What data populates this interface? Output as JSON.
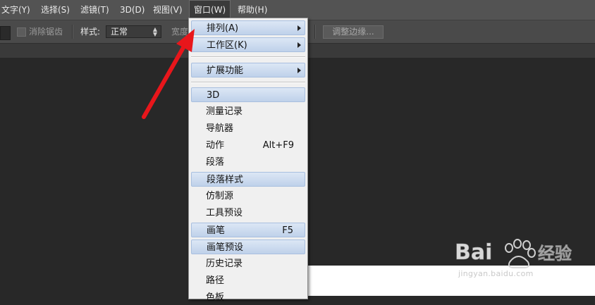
{
  "menubar": {
    "items": [
      "文字(Y)",
      "选择(S)",
      "滤镜(T)",
      "3D(D)",
      "视图(V)",
      "窗口(W)",
      "帮助(H)"
    ]
  },
  "options": {
    "antialias_label": "消除锯齿",
    "style_label": "样式:",
    "style_value": "正常",
    "width_label": "宽度",
    "refine_edge_label": "调整边缘..."
  },
  "window_menu": {
    "items": [
      {
        "label": "排列(A)",
        "shortcut": "",
        "submenu": true,
        "highlighted": true
      },
      {
        "label": "工作区(K)",
        "shortcut": "",
        "submenu": true,
        "highlighted": true
      },
      {
        "label": "扩展功能",
        "shortcut": "",
        "submenu": true,
        "highlighted": true
      },
      {
        "label": "3D",
        "shortcut": "",
        "submenu": false,
        "highlighted": true
      },
      {
        "label": "测量记录",
        "shortcut": "",
        "submenu": false,
        "highlighted": false
      },
      {
        "label": "导航器",
        "shortcut": "",
        "submenu": false,
        "highlighted": false
      },
      {
        "label": "动作",
        "shortcut": "Alt+F9",
        "submenu": false,
        "highlighted": false
      },
      {
        "label": "段落",
        "shortcut": "",
        "submenu": false,
        "highlighted": false
      },
      {
        "label": "段落样式",
        "shortcut": "",
        "submenu": false,
        "highlighted": true
      },
      {
        "label": "仿制源",
        "shortcut": "",
        "submenu": false,
        "highlighted": false
      },
      {
        "label": "工具预设",
        "shortcut": "",
        "submenu": false,
        "highlighted": false
      },
      {
        "label": "画笔",
        "shortcut": "F5",
        "submenu": false,
        "highlighted": true
      },
      {
        "label": "画笔预设",
        "shortcut": "",
        "submenu": false,
        "highlighted": true
      },
      {
        "label": "历史记录",
        "shortcut": "",
        "submenu": false,
        "highlighted": false
      },
      {
        "label": "路径",
        "shortcut": "",
        "submenu": false,
        "highlighted": false
      },
      {
        "label": "色板",
        "shortcut": "",
        "submenu": false,
        "highlighted": false
      }
    ]
  },
  "annotation": {
    "arrow_color": "#e8161b"
  },
  "watermark": {
    "brand": "Baidu经验",
    "url": "jingyan.baidu.com"
  }
}
